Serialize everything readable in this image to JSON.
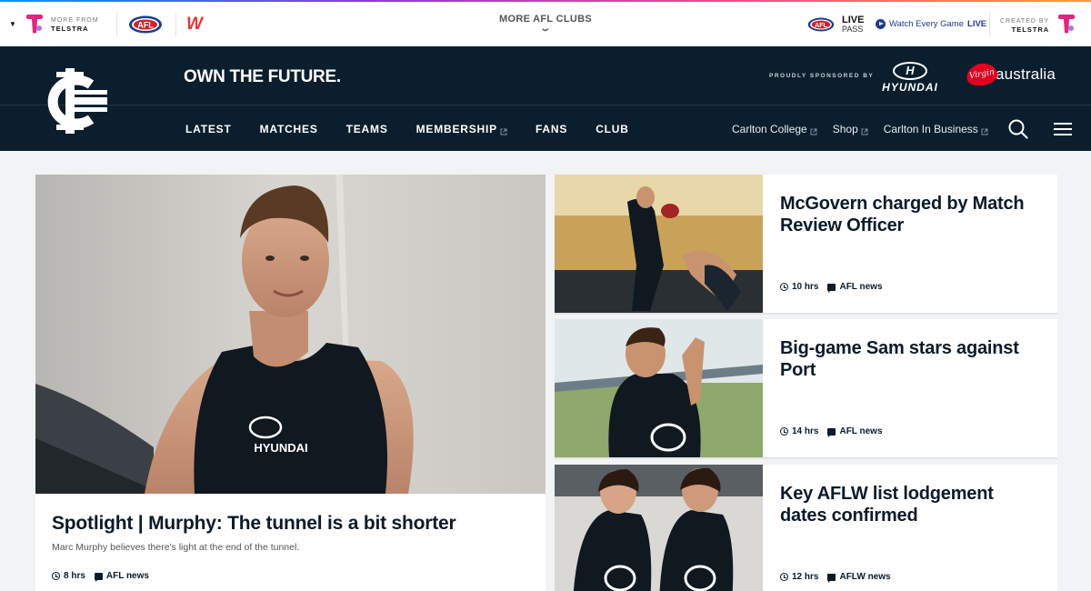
{
  "topbar": {
    "more_from_label": "MORE FROM",
    "more_from_brand": "TELSTRA",
    "afl_logo_text": "AFL",
    "aflw_logo_text": "W",
    "more_clubs_label": "MORE AFL CLUBS",
    "livepass_line1": "LIVE",
    "livepass_line2": "PASS",
    "watch_text": "Watch Every Game",
    "watch_emphasis": "LIVE",
    "created_by_label": "CREATED BY",
    "created_by_brand": "TELSTRA",
    "accent_gradient": [
      "#0099f8",
      "#8a3bd6",
      "#f24b8c",
      "#ff9a3c"
    ]
  },
  "header": {
    "tagline": "OWN THE FUTURE.",
    "sponsor_label": "PROUDLY SPONSORED BY",
    "sponsor1_mark": "H",
    "sponsor1_name": "HYUNDAI",
    "sponsor2_badge": "Virgin",
    "sponsor2_name": "australia",
    "bg_color": "#0b1e2d"
  },
  "nav": {
    "items": [
      {
        "label": "LATEST",
        "external": false
      },
      {
        "label": "MATCHES",
        "external": false
      },
      {
        "label": "TEAMS",
        "external": false
      },
      {
        "label": "MEMBERSHIP",
        "external": true
      },
      {
        "label": "FANS",
        "external": false
      },
      {
        "label": "CLUB",
        "external": false
      }
    ],
    "secondary": [
      {
        "label": "Carlton College"
      },
      {
        "label": "Shop"
      },
      {
        "label": "Carlton In Business"
      }
    ]
  },
  "feature": {
    "title": "Spotlight | Murphy: The tunnel is a bit shorter",
    "subtitle": "Marc Murphy believes there's light at the end of the tunnel.",
    "time": "8 hrs",
    "category": "AFL news",
    "jersey_sponsor": "HYUNDAI"
  },
  "stories": [
    {
      "title": "McGovern charged by Match Review Officer",
      "time": "10 hrs",
      "category": "AFL news"
    },
    {
      "title": "Big-game Sam stars against Port",
      "time": "14 hrs",
      "category": "AFL news"
    },
    {
      "title": "Key AFLW list lodgement dates confirmed",
      "time": "12 hrs",
      "category": "AFLW news"
    }
  ]
}
